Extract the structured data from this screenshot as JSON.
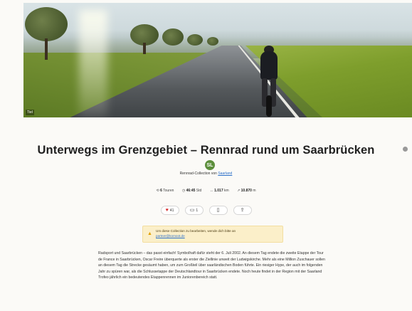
{
  "hero": {
    "credit": "Tiel",
    "alt": "Rennradfahrer auf einer Landstraße zwischen Feldern"
  },
  "title": "Unterwegs im Grenzgebiet – Rennrad rund um Saarbrücken",
  "avatar": {
    "initials": "SL"
  },
  "byline": {
    "prefix": "Rennrad-Collection von",
    "author": "Saarland"
  },
  "stats": {
    "tours_value": "6",
    "tours_label": "Touren",
    "duration_value": "46:45",
    "duration_unit": "Std",
    "distance_value": "1.017",
    "distance_unit": "km",
    "elevation_value": "10.870",
    "elevation_unit": "m"
  },
  "actions": {
    "likes": "41",
    "comments": "1"
  },
  "notice": {
    "text": "Um diese Collection zu bearbeiten, wende dich bitte an",
    "email": "partner@komoot.de"
  },
  "description": "Radsport und Saarbrücken – das passt einfach! Symbolhaft dafür steht der 6. Juli 2002. An diesem Tag endete die zweite Etappe der Tour de France in Saarbrücken, Oscar Freire überquerte als erster die Ziellinie unweit der Ludwigskirche. Mehr als eine Million Zuschauer sollen an diesem Tag die Strecke gesäumt haben, um zum Großteil über saarländischen Boden führte. Ein riesiger Hype, der auch im folgenden Jahr zu spüren war, als die Schlussetappe der Deutschlandtour in Saarbrücken endete. Noch heute findet in der Region mit der Saarland Trofeo jährlich ein bedeutendes Etappenrennen im Juniorenbereich statt.",
  "colors": {
    "accent": "#2a6fc9",
    "like": "#d62b2b",
    "notice_bg": "#fbefc9",
    "avatar": "#5d8f3c"
  }
}
